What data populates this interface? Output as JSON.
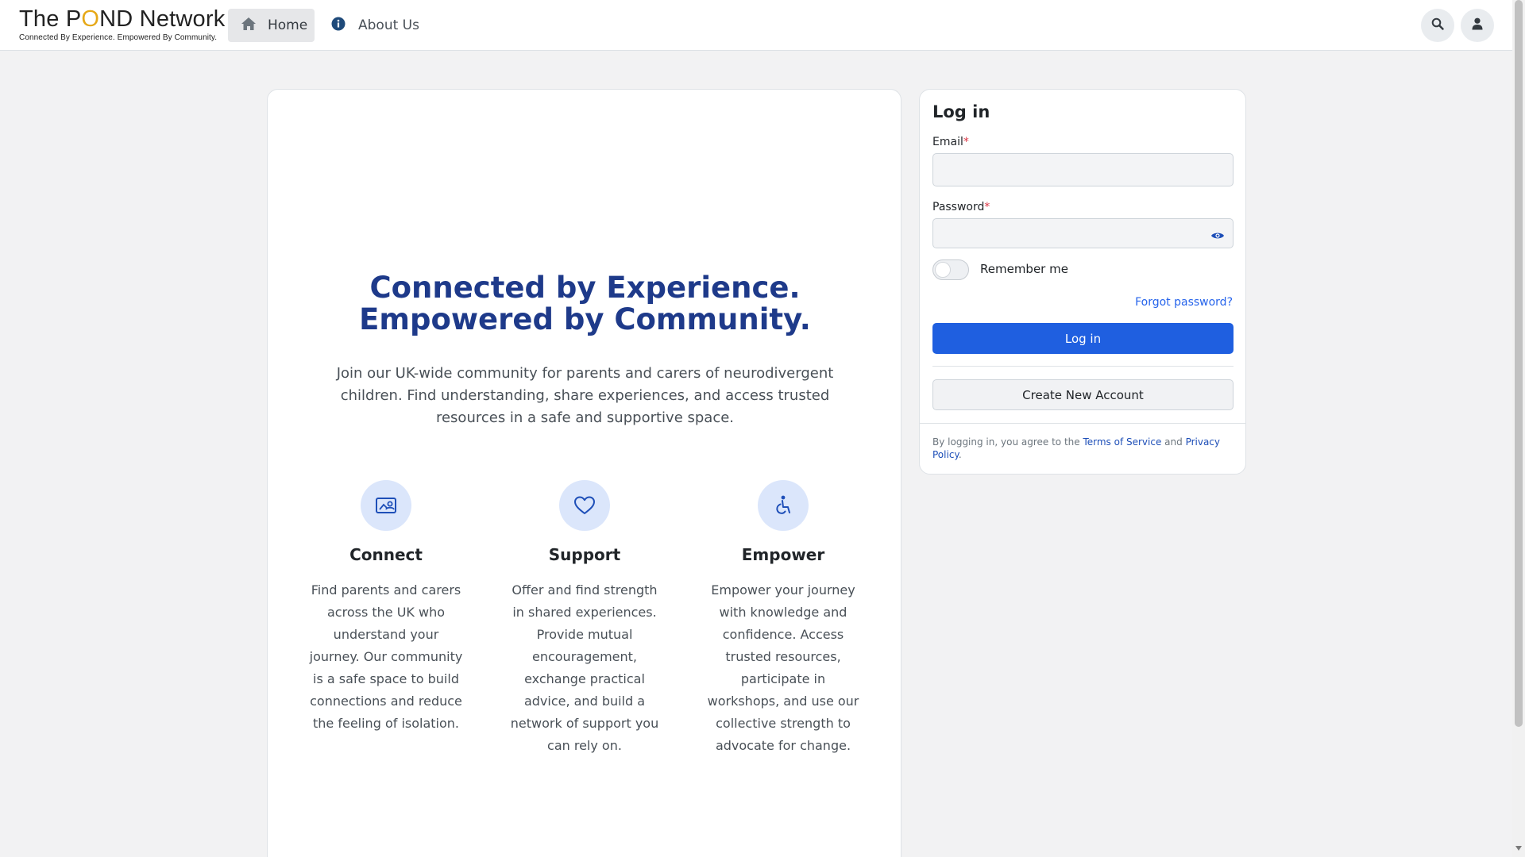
{
  "header": {
    "logo_title_pre": "The P",
    "logo_title_o": "O",
    "logo_title_post": "ND Network",
    "logo_tagline": "Connected By Experience. Empowered By Community.",
    "nav_home": "Home",
    "nav_about": "About Us",
    "icons": [
      "home-icon",
      "info-icon",
      "search-icon",
      "user-icon"
    ]
  },
  "hero": {
    "title_line1": "Connected by Experience.",
    "title_line2": "Empowered by Community.",
    "subtitle": "Join our UK-wide community for parents and carers of neurodivergent children. Find understanding, share experiences, and access trusted resources in a safe and supportive space.",
    "features": [
      {
        "title": "Connect",
        "icon": "connect-icon",
        "text": "Find parents and carers across the UK who understand your journey. Our community is a safe space to build connections and reduce the feeling of isolation."
      },
      {
        "title": "Support",
        "icon": "heart-icon",
        "text": "Offer and find strength in shared experiences. Provide mutual encouragement, exchange practical advice, and build a network of support you can rely on."
      },
      {
        "title": "Empower",
        "icon": "accessibility-icon",
        "text": "Empower your journey with knowledge and confidence. Access trusted resources, participate in workshops, and use our collective strength to advocate for change."
      }
    ]
  },
  "login": {
    "title": "Log in",
    "email_label": "Email",
    "password_label": "Password",
    "required_mark": "*",
    "email_value": "",
    "password_value": "",
    "remember_label": "Remember me",
    "remember_checked": false,
    "forgot_link": "Forgot password?",
    "login_button": "Log in",
    "create_button": "Create New Account",
    "terms_prefix": "By logging in, you agree to the ",
    "terms_link": "Terms of Service",
    "terms_and": " and ",
    "privacy_link": "Privacy Policy",
    "terms_suffix": "."
  },
  "colors": {
    "brand_blue": "#1e3a8a",
    "primary_button": "#1f5fe0",
    "logo_accent": "#e6a817",
    "icon_bg": "#dbe6fb"
  }
}
